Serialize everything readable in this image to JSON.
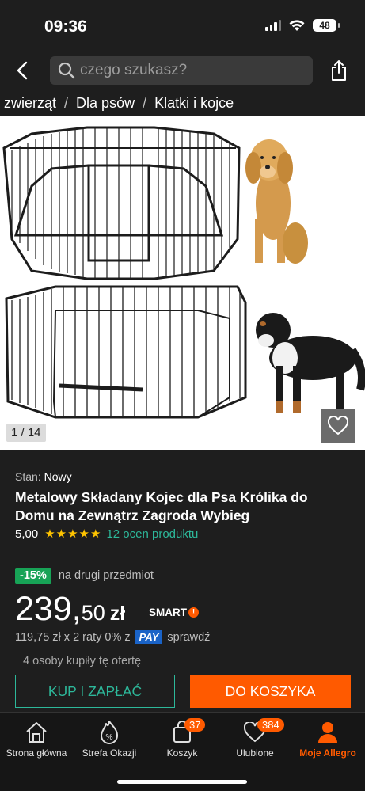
{
  "status": {
    "time": "09:36",
    "battery": "48"
  },
  "header": {
    "search_placeholder": "czego szukasz?"
  },
  "breadcrumb": [
    "la zwierząt",
    "Dla psów",
    "Klatki i kojce"
  ],
  "gallery": {
    "counter": "1 / 14"
  },
  "product": {
    "condition_label": "Stan:",
    "condition_value": "Nowy",
    "title": "Metalowy Składany Kojec dla Psa Królika do Domu na Zewnątrz Zagroda Wybieg",
    "rating_score": "5,00",
    "rating_stars": 5,
    "reviews": "12 ocen produktu",
    "discount_badge": "-15%",
    "discount_desc": "na drugi przedmiot",
    "price_big": "239,",
    "price_small": "50",
    "price_currency": "zł",
    "smart_label": "SMART",
    "installment_text": "119,75 zł x 2 raty 0% z",
    "pay_label": "PAY",
    "installment_check": "sprawdź",
    "buyers": "4 osoby kupiły tę ofertę"
  },
  "actions": {
    "buy_now": "KUP I ZAPŁAĆ",
    "add_to_cart": "DO KOSZYKA"
  },
  "tabs": [
    {
      "label": "Strona główna",
      "icon": "home-icon"
    },
    {
      "label": "Strefa Okazji",
      "icon": "deals-icon"
    },
    {
      "label": "Koszyk",
      "icon": "cart-icon",
      "count": "37"
    },
    {
      "label": "Ulubione",
      "icon": "heart-icon",
      "count": "384"
    },
    {
      "label": "Moje Allegro",
      "icon": "user-icon"
    }
  ],
  "colors": {
    "accent": "#ff5a00",
    "teal": "#2db89a",
    "background": "#1e1e1e",
    "star": "#ffc400",
    "discount": "#17a356"
  }
}
